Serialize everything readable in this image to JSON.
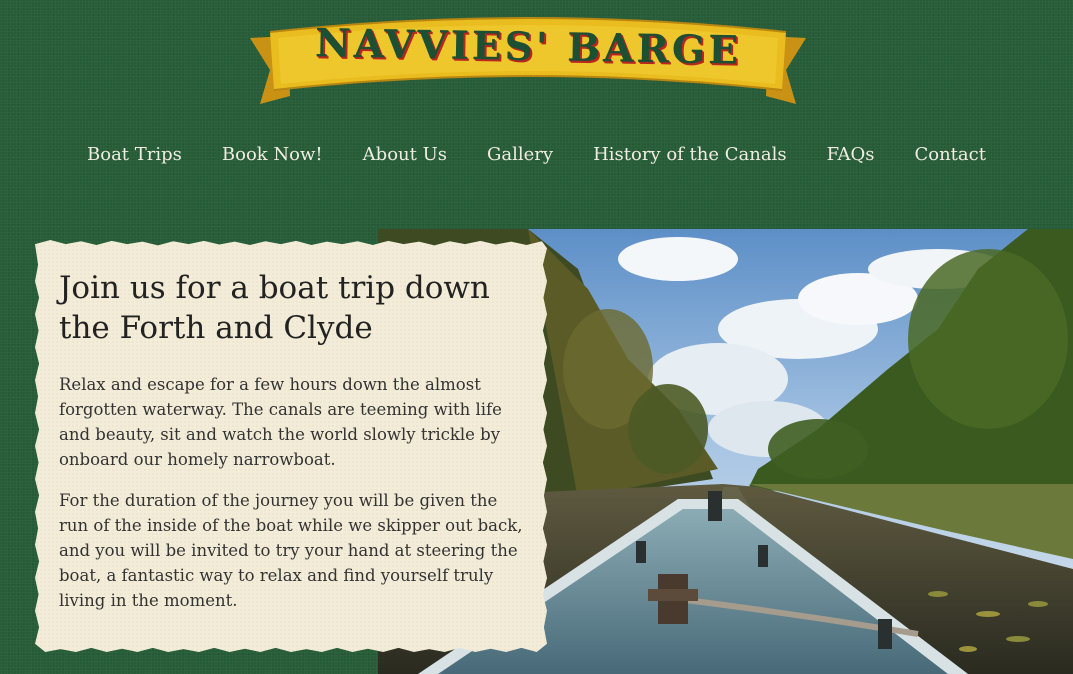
{
  "logo": {
    "text": "NAVVIES' BARGE",
    "banner_color": "#e9bd1f",
    "text_color": "#1d4f33",
    "shadow_color": "#b8261f"
  },
  "nav": {
    "items": [
      {
        "label": "Boat Trips"
      },
      {
        "label": "Book Now!"
      },
      {
        "label": "About Us"
      },
      {
        "label": "Gallery"
      },
      {
        "label": "History of the Canals"
      },
      {
        "label": "FAQs"
      },
      {
        "label": "Contact"
      }
    ]
  },
  "intro": {
    "heading": "Join us for a boat trip down the Forth and Clyde",
    "paragraphs": [
      "Relax and escape for a few hours down the almost forgotten waterway. The canals are teeming with life and beauty, sit and watch the world slowly trickle by onboard our homely narrowboat.",
      "For the duration of the journey you will be given the run of the inside of the boat while we skipper out back, and you will be invited to try your hand at steering the boat, a fantastic way to relax and find yourself truly living in the moment."
    ]
  },
  "colors": {
    "background": "#265c38",
    "paper": "#f2ecd8",
    "nav_text": "#f1ece0"
  }
}
